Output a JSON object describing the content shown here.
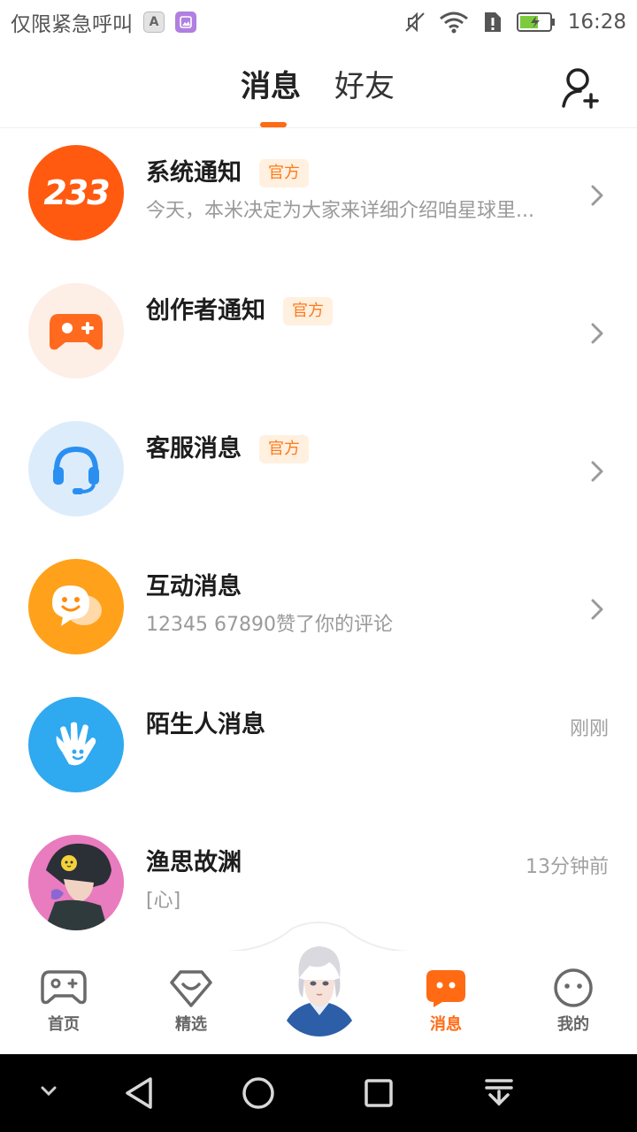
{
  "status_bar": {
    "carrier_text": "仅限紧急呼叫",
    "badge_a": "A",
    "time": "16:28",
    "icons": [
      "mute-icon",
      "wifi-icon",
      "sim-alert-icon",
      "battery-charging-icon"
    ]
  },
  "header": {
    "tab_active": "消息",
    "tab_inactive": "好友",
    "add_friend_icon": "add-friend-icon"
  },
  "messages": [
    {
      "title": "系统通知",
      "tag": "官方",
      "subtitle": "今天，本米决定为大家来详细介绍咱星球里...",
      "time": "",
      "avatar_text": "233",
      "avatar_icon": "system-233-icon",
      "has_chevron": true
    },
    {
      "title": "创作者通知",
      "tag": "官方",
      "subtitle": "",
      "time": "",
      "avatar_icon": "gamepad-plus-icon",
      "has_chevron": true
    },
    {
      "title": "客服消息",
      "tag": "官方",
      "subtitle": "",
      "time": "",
      "avatar_icon": "headset-icon",
      "has_chevron": true
    },
    {
      "title": "互动消息",
      "tag": "",
      "subtitle": "12345 67890赞了你的评论",
      "time": "",
      "avatar_icon": "chat-bubble-smile-icon",
      "has_chevron": true
    },
    {
      "title": "陌生人消息",
      "tag": "",
      "subtitle": "",
      "time": "刚刚",
      "avatar_icon": "waving-hand-icon",
      "has_chevron": false
    },
    {
      "title": "渔思故渊",
      "tag": "",
      "subtitle": "[心]",
      "time": "13分钟前",
      "avatar_icon": "user-avatar",
      "has_chevron": false
    }
  ],
  "bottom_nav": {
    "items": [
      {
        "label": "首页",
        "icon": "gamepad-icon",
        "active": false
      },
      {
        "label": "精选",
        "icon": "heart-diamond-icon",
        "active": false
      },
      {
        "label": "",
        "icon": "character-avatar",
        "active": false
      },
      {
        "label": "消息",
        "icon": "message-bubble-icon",
        "active": true
      },
      {
        "label": "我的",
        "icon": "face-icon",
        "active": false
      }
    ]
  },
  "colors": {
    "accent": "#ff6a13",
    "tag_bg": "#fff0e0",
    "system_avatar": "#ff5a10",
    "creator_avatar_bg": "#fdeee6",
    "support_avatar_bg": "#dcecfb",
    "interaction_avatar": "#ffa11a",
    "stranger_avatar": "#2fa9ef"
  }
}
